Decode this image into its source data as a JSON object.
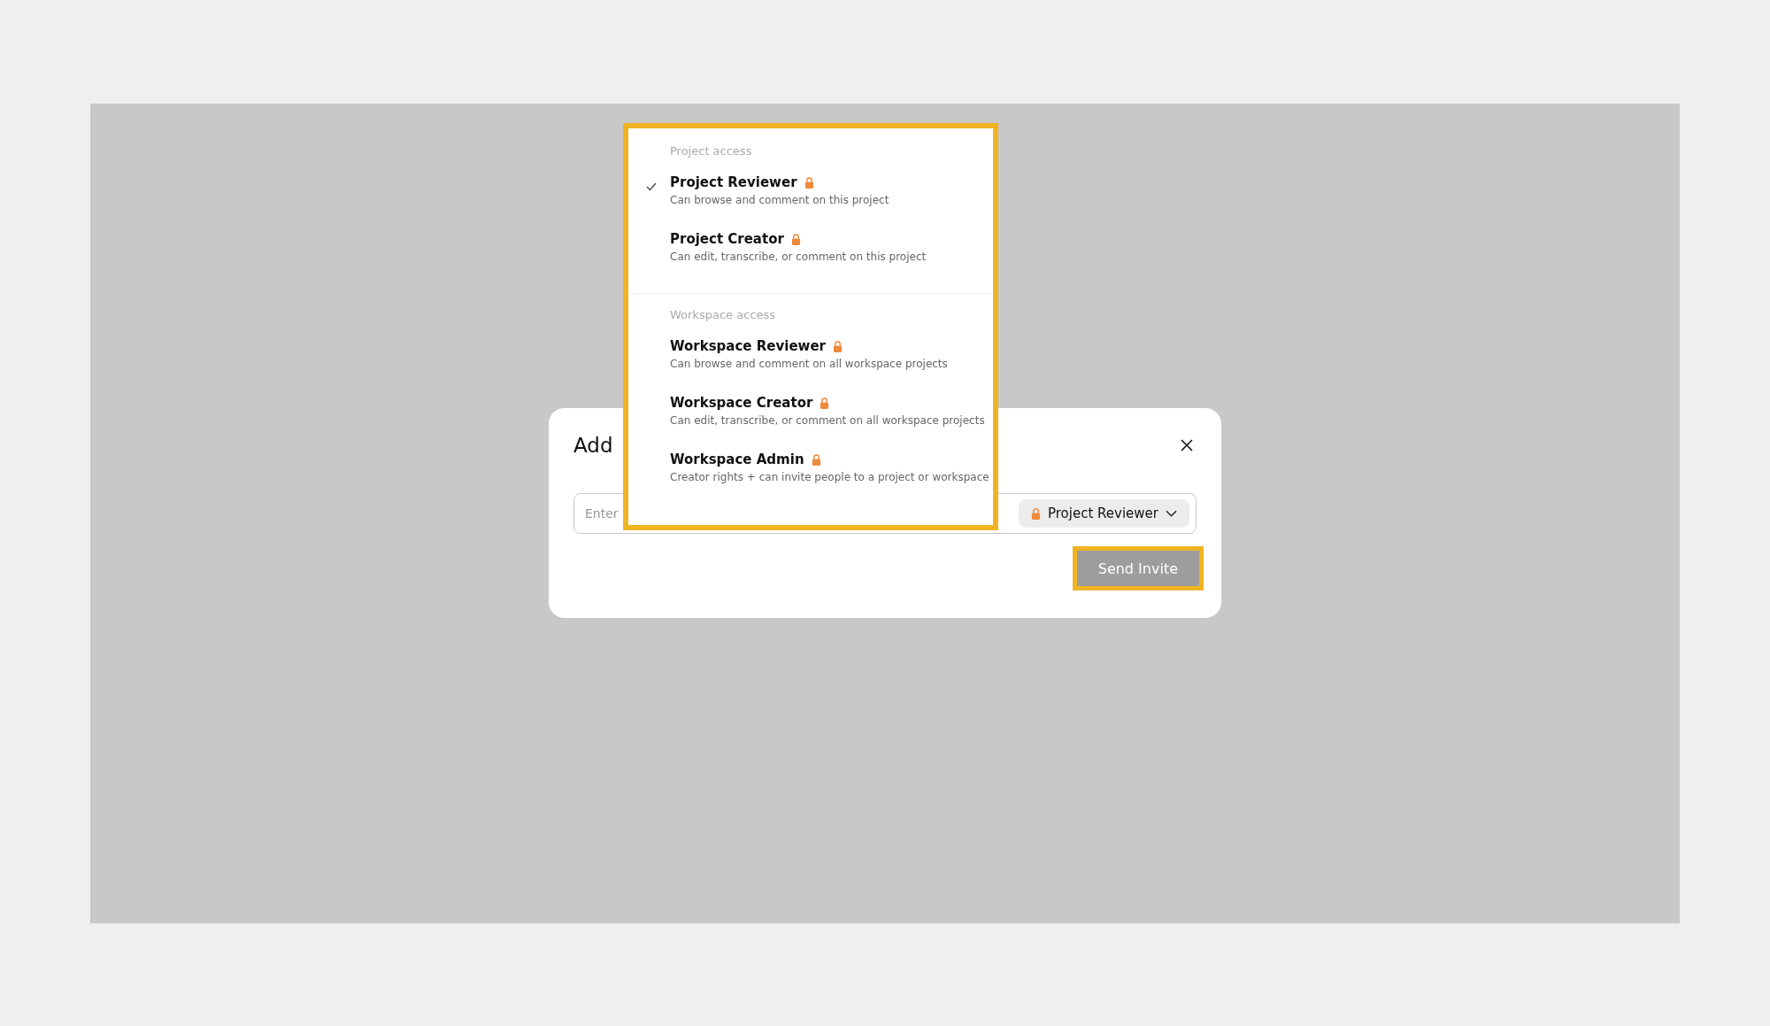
{
  "dialog": {
    "title": "Add",
    "email_field": {
      "placeholder": "Enter"
    },
    "role_select": {
      "value": "Project Reviewer",
      "locked": true
    },
    "send_button": {
      "label": "Send Invite",
      "highlighted": true
    }
  },
  "role_menu": {
    "highlighted": true,
    "groups": [
      {
        "heading": "Project access",
        "options": [
          {
            "label": "Project Reviewer",
            "description": "Can browse and comment on this project",
            "selected": true,
            "locked": true
          },
          {
            "label": "Project Creator",
            "description": "Can edit, transcribe, or comment on this project",
            "selected": false,
            "locked": true
          }
        ]
      },
      {
        "heading": "Workspace access",
        "options": [
          {
            "label": "Workspace Reviewer",
            "description": "Can browse and comment on all workspace projects",
            "selected": false,
            "locked": true
          },
          {
            "label": "Workspace Creator",
            "description": "Can edit, transcribe, or comment on all workspace projects",
            "selected": false,
            "locked": true
          },
          {
            "label": "Workspace Admin",
            "description": "Creator rights + can invite people to a project or workspace",
            "selected": false,
            "locked": true
          }
        ]
      }
    ]
  }
}
